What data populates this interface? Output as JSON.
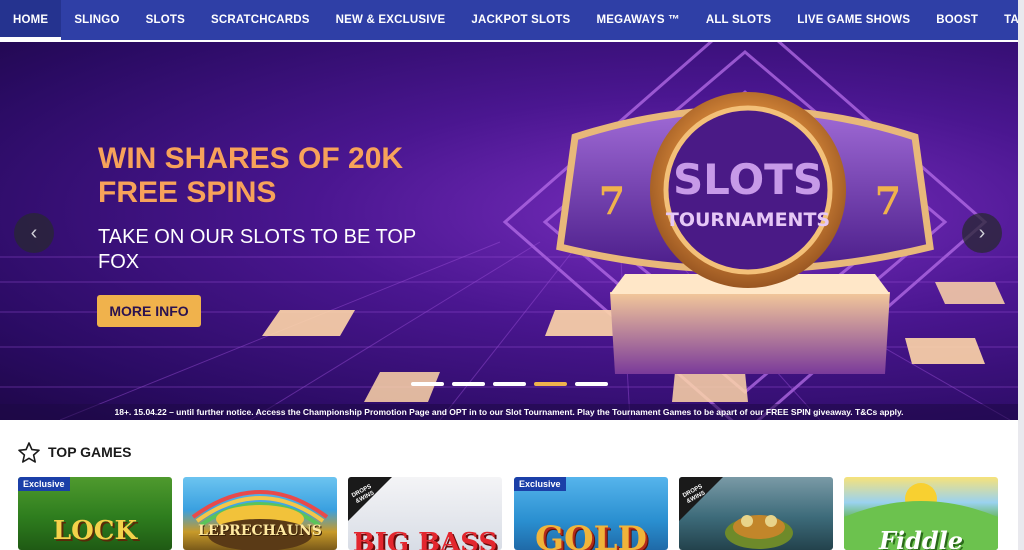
{
  "nav": {
    "items": [
      {
        "label": "HOME",
        "active": true
      },
      {
        "label": "SLINGO"
      },
      {
        "label": "SLOTS"
      },
      {
        "label": "SCRATCHCARDS"
      },
      {
        "label": "NEW & EXCLUSIVE"
      },
      {
        "label": "JACKPOT SLOTS"
      },
      {
        "label": "MEGAWAYS ™"
      },
      {
        "label": "ALL SLOTS"
      },
      {
        "label": "LIVE GAME SHOWS"
      },
      {
        "label": "BOOST"
      },
      {
        "label": "TABLES"
      }
    ]
  },
  "hero": {
    "title": "WIN SHARES OF 20K FREE SPINS",
    "subtitle": "TAKE ON OUR SLOTS TO BE TOP FOX",
    "cta_label": "MORE INFO",
    "image_text": {
      "line1": "SLOTS",
      "line2": "TOURNAMENTS",
      "numeral": "7"
    },
    "terms": "18+. 15.04.22 – until further notice. Access the Championship Promotion Page and OPT in to our Slot Tournament. Play the Tournament Games to be apart of our FREE SPIN giveaway. T&Cs apply.",
    "prev_glyph": "‹",
    "next_glyph": "›",
    "slides": 5,
    "active_slide": 4
  },
  "top_games": {
    "title": "TOP GAMES",
    "icon": "star-outline-icon",
    "exclusive_label": "Exclusive",
    "drops_label_1": "DROPS",
    "drops_label_2": "&WINS",
    "tiles": [
      {
        "title": "LOCK",
        "badge": "exclusive",
        "color": "#2e7d1e"
      },
      {
        "title": "LEPRECHAUNS",
        "badge": "none",
        "color": "#3aa0e0"
      },
      {
        "title": "BIG BASS",
        "badge": "drops",
        "color": "#e8e8ea"
      },
      {
        "title": "GOLD",
        "badge": "exclusive",
        "color": "#2a8fd0"
      },
      {
        "title": "",
        "badge": "drops",
        "color": "#3d6b7a"
      },
      {
        "title": "Fiddle",
        "badge": "none",
        "color": "#5fb24a"
      }
    ]
  },
  "colors": {
    "nav_bg": "#2f3fa6",
    "accent_orange": "#f7a25a",
    "cta_bg": "#f0b24c"
  }
}
